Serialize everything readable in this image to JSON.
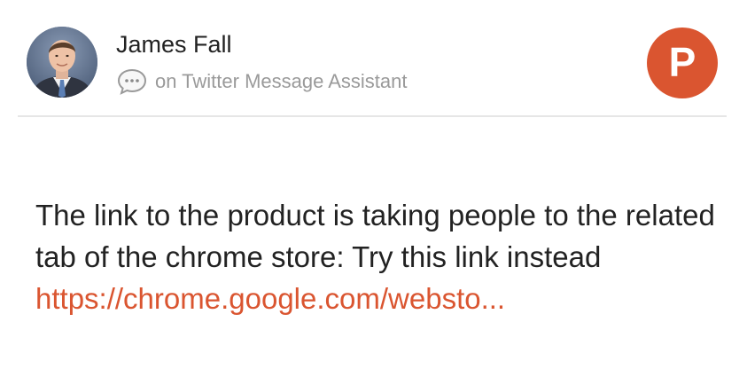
{
  "comment": {
    "author_name": "James Fall",
    "source_text": "on Twitter Message Assistant",
    "message_text": "The link to the product is taking people to the related tab of the chrome store: Try this link instead",
    "link_text": "https://chrome.google.com/websto...",
    "avatar_icon": "user-avatar-photo",
    "source_icon": "speech-bubble-icon"
  },
  "brand": {
    "logo_letter": "P",
    "logo_icon": "product-hunt-logo",
    "accent_color": "#da5530"
  },
  "colors": {
    "text": "#222222",
    "muted_text": "#9a9a9a",
    "divider": "#e6e6e6",
    "link": "#da5530"
  }
}
